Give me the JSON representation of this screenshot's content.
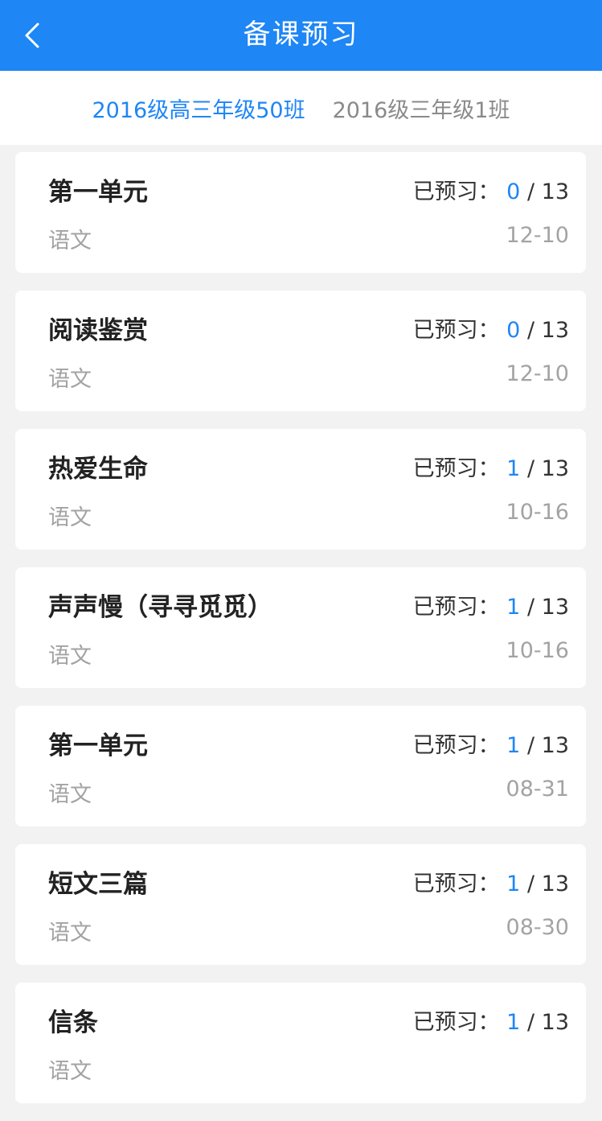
{
  "header": {
    "title": "备课预习",
    "back_icon": "chevron-left-icon"
  },
  "tabs": [
    {
      "label": "2016级高三年级50班",
      "active": true
    },
    {
      "label": "2016级三年级1班",
      "active": false
    }
  ],
  "progress_label": "已预习：",
  "lessons": [
    {
      "title": "第一单元",
      "subject": "语文",
      "date": "12-10",
      "done": "0",
      "total": "13"
    },
    {
      "title": "阅读鉴赏",
      "subject": "语文",
      "date": "12-10",
      "done": "0",
      "total": "13"
    },
    {
      "title": "热爱生命",
      "subject": "语文",
      "date": "10-16",
      "done": "1",
      "total": "13"
    },
    {
      "title": "声声慢（寻寻觅觅）",
      "subject": "语文",
      "date": "10-16",
      "done": "1",
      "total": "13"
    },
    {
      "title": "第一单元",
      "subject": "语文",
      "date": "08-31",
      "done": "1",
      "total": "13"
    },
    {
      "title": "短文三篇",
      "subject": "语文",
      "date": "08-30",
      "done": "1",
      "total": "13"
    },
    {
      "title": "信条",
      "subject": "语文",
      "date": "",
      "done": "1",
      "total": "13"
    }
  ],
  "colors": {
    "accent": "#1e86f5",
    "background": "#f2f2f2",
    "card": "#ffffff",
    "title_text": "#222222",
    "muted_text": "#a3a3a3"
  }
}
